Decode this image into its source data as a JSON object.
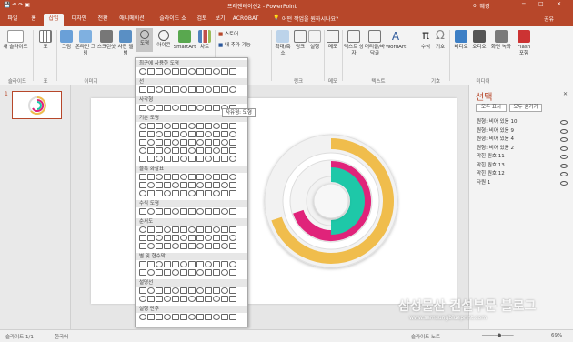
{
  "titlebar": {
    "title": "프레젠테이션2 - PowerPoint",
    "user": "이 혜경",
    "controls": [
      "─",
      "□",
      "✕"
    ]
  },
  "tabs": [
    "파일",
    "홈",
    "삽입",
    "디자인",
    "전환",
    "애니메이션",
    "슬라이드 쇼",
    "검토",
    "보기",
    "ACROBAT"
  ],
  "active_tab": "삽입",
  "tell_me": "어떤 작업을 원하시나요?",
  "share": "공유",
  "ribbon": {
    "buttons": [
      "새 슬라이드",
      "표",
      "그림",
      "온라인 그림",
      "스크린샷",
      "사진 앨범",
      "도형",
      "아이콘",
      "SmartArt",
      "차트",
      "스토어",
      "내 추가 기능",
      "확대/축소",
      "링크",
      "실행",
      "메모",
      "텍스트 상자",
      "머리글/바닥글",
      "WordArt",
      "수식",
      "기호",
      "비디오",
      "오디오",
      "화면 녹화",
      "Flash 포함"
    ],
    "groups": [
      "슬라이드",
      "표",
      "이미지",
      "링크",
      "메모",
      "텍스트",
      "기호",
      "미디어"
    ]
  },
  "gallery": {
    "sections": [
      "최근에 사용한 도형",
      "선",
      "사각형",
      "기본 도형",
      "블록 화살표",
      "수식 도형",
      "순서도",
      "별 및 현수막",
      "설명선",
      "실행 단추"
    ],
    "tooltip": "자유형: 도형"
  },
  "slide_number": "1",
  "selection_pane": {
    "title": "선택",
    "close": "✕",
    "show_all": "모두 표시",
    "hide_all": "모두 숨기기",
    "items": [
      "원형: 비어 있음 10",
      "원형: 비어 있음 9",
      "원형: 비어 있음 4",
      "원형: 비어 있음 2",
      "막힌 원호 11",
      "막힌 원호 13",
      "막힌 원호 12",
      "타원 1"
    ]
  },
  "colors": {
    "accent": "#b7472a",
    "teal": "#1ec8a8",
    "magenta": "#e0237a",
    "gold": "#f0bd4c"
  },
  "progress": {
    "teal_arc_fraction": 0.5,
    "magenta_arc_fraction": 0.7,
    "gold_arc_fraction": 0.7
  },
  "statusbar": {
    "slide_info": "슬라이드 1/1",
    "language": "한국어",
    "notes": "슬라이드 노트",
    "zoom": "69%"
  },
  "watermark": {
    "title": "삼성물산 건설부문 블로그",
    "url": "www.samsungblueprint.com"
  }
}
